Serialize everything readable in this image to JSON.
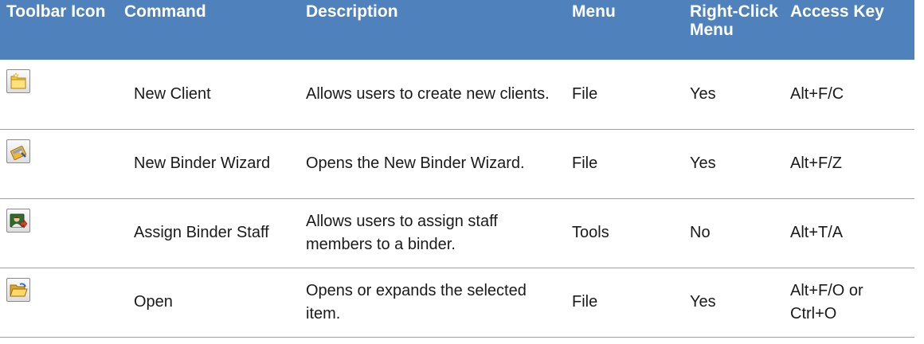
{
  "columns": [
    "Toolbar Icon",
    "Command",
    "Description",
    "Menu",
    "Right-Click Menu",
    "Access Key"
  ],
  "rows": [
    {
      "icon": "new-client-folder-icon",
      "command": "New Client",
      "description": "Allows users to create new clients.",
      "menu": "File",
      "right_click": "Yes",
      "access_key": "Alt+F/C"
    },
    {
      "icon": "new-binder-wizard-icon",
      "command": "New Binder Wizard",
      "description": "Opens the New Binder Wizard.",
      "menu": "File",
      "right_click": "Yes",
      "access_key": "Alt+F/Z"
    },
    {
      "icon": "assign-binder-staff-icon",
      "command": "Assign Binder Staff",
      "description": "Allows users to assign staff members to a binder.",
      "menu": "Tools",
      "right_click": "No",
      "access_key": "Alt+T/A"
    },
    {
      "icon": "open-folder-icon",
      "command": "Open",
      "description": "Opens or expands the selected item.",
      "menu": "File",
      "right_click": "Yes",
      "access_key": "Alt+F/O or Ctrl+O"
    }
  ],
  "colors": {
    "header_bg": "#4f81bd",
    "header_text": "#ffffff",
    "row_border": "#a0a0a0"
  }
}
